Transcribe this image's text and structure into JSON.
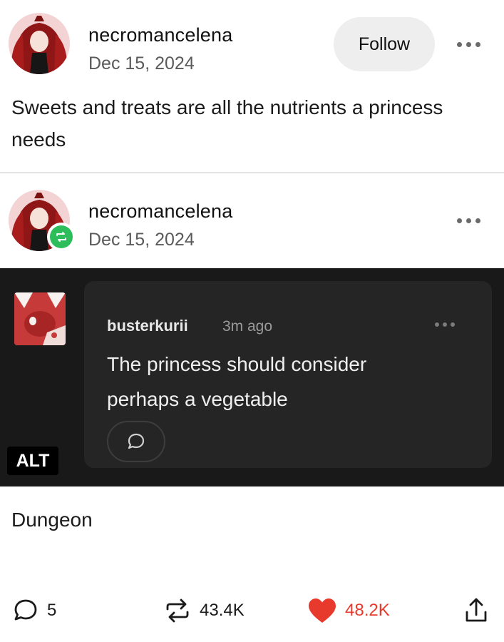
{
  "original_post": {
    "username": "necromancelena",
    "date": "Dec 15, 2024",
    "follow_label": "Follow",
    "text": "Sweets and treats are all the nutrients a princess needs"
  },
  "reblog_post": {
    "username": "necromancelena",
    "date": "Dec 15, 2024"
  },
  "image": {
    "comment_user": "busterkurii",
    "comment_time": "3m ago",
    "comment_text": "The princess should consider perhaps a vegetable",
    "alt_label": "ALT"
  },
  "caption": "Dungeon",
  "actions": {
    "replies": "5",
    "reblogs": "43.4K",
    "likes": "48.2K"
  },
  "colors": {
    "like": "#e8392d",
    "reblog_badge": "#2dbd5b",
    "dark_bg": "#191919"
  }
}
